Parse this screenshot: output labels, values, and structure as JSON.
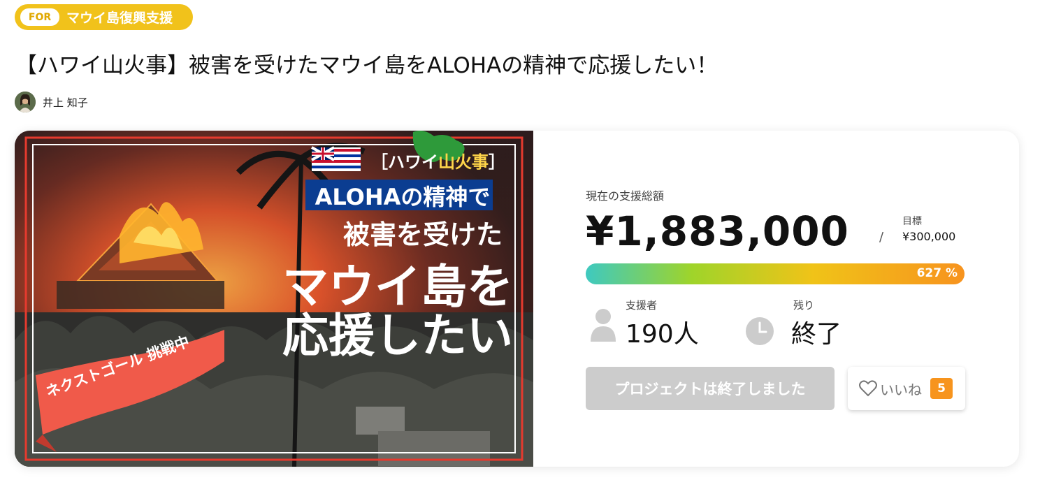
{
  "badge": {
    "for_label": "FOR",
    "text": "マウイ島復興支援"
  },
  "title": "【ハワイ山火事】被害を受けたマウイ島をALOHAの精神で応援したい！",
  "author": {
    "name": "井上 知子"
  },
  "hero": {
    "tag": "ハワイ",
    "tag_highlight": "山火事",
    "line1": "ALOHAの精神で",
    "line2": "被害を受けた",
    "line3": "マウイ島を",
    "line4": "応援したい",
    "ribbon": "ネクストゴール 挑戦中"
  },
  "funding": {
    "current_label": "現在の支援総額",
    "amount": "¥1,883,000",
    "slash": "/",
    "goal_label": "目標",
    "goal_value": "¥300,000",
    "percent_label": "627 %",
    "percent": 627
  },
  "stats": {
    "supporters_label": "支援者",
    "supporters_value": "190人",
    "remaining_label": "残り",
    "remaining_value": "終了"
  },
  "actions": {
    "ended_label": "プロジェクトは終了しました",
    "like_label": "いいね",
    "like_count": "5"
  },
  "colors": {
    "badge": "#f1c21b",
    "progress_start": "#3ec9c0",
    "progress_end": "#f7931e",
    "like_count": "#f7941d",
    "ribbon": "#f05a4a",
    "aloha_box": "#0b3d91"
  }
}
